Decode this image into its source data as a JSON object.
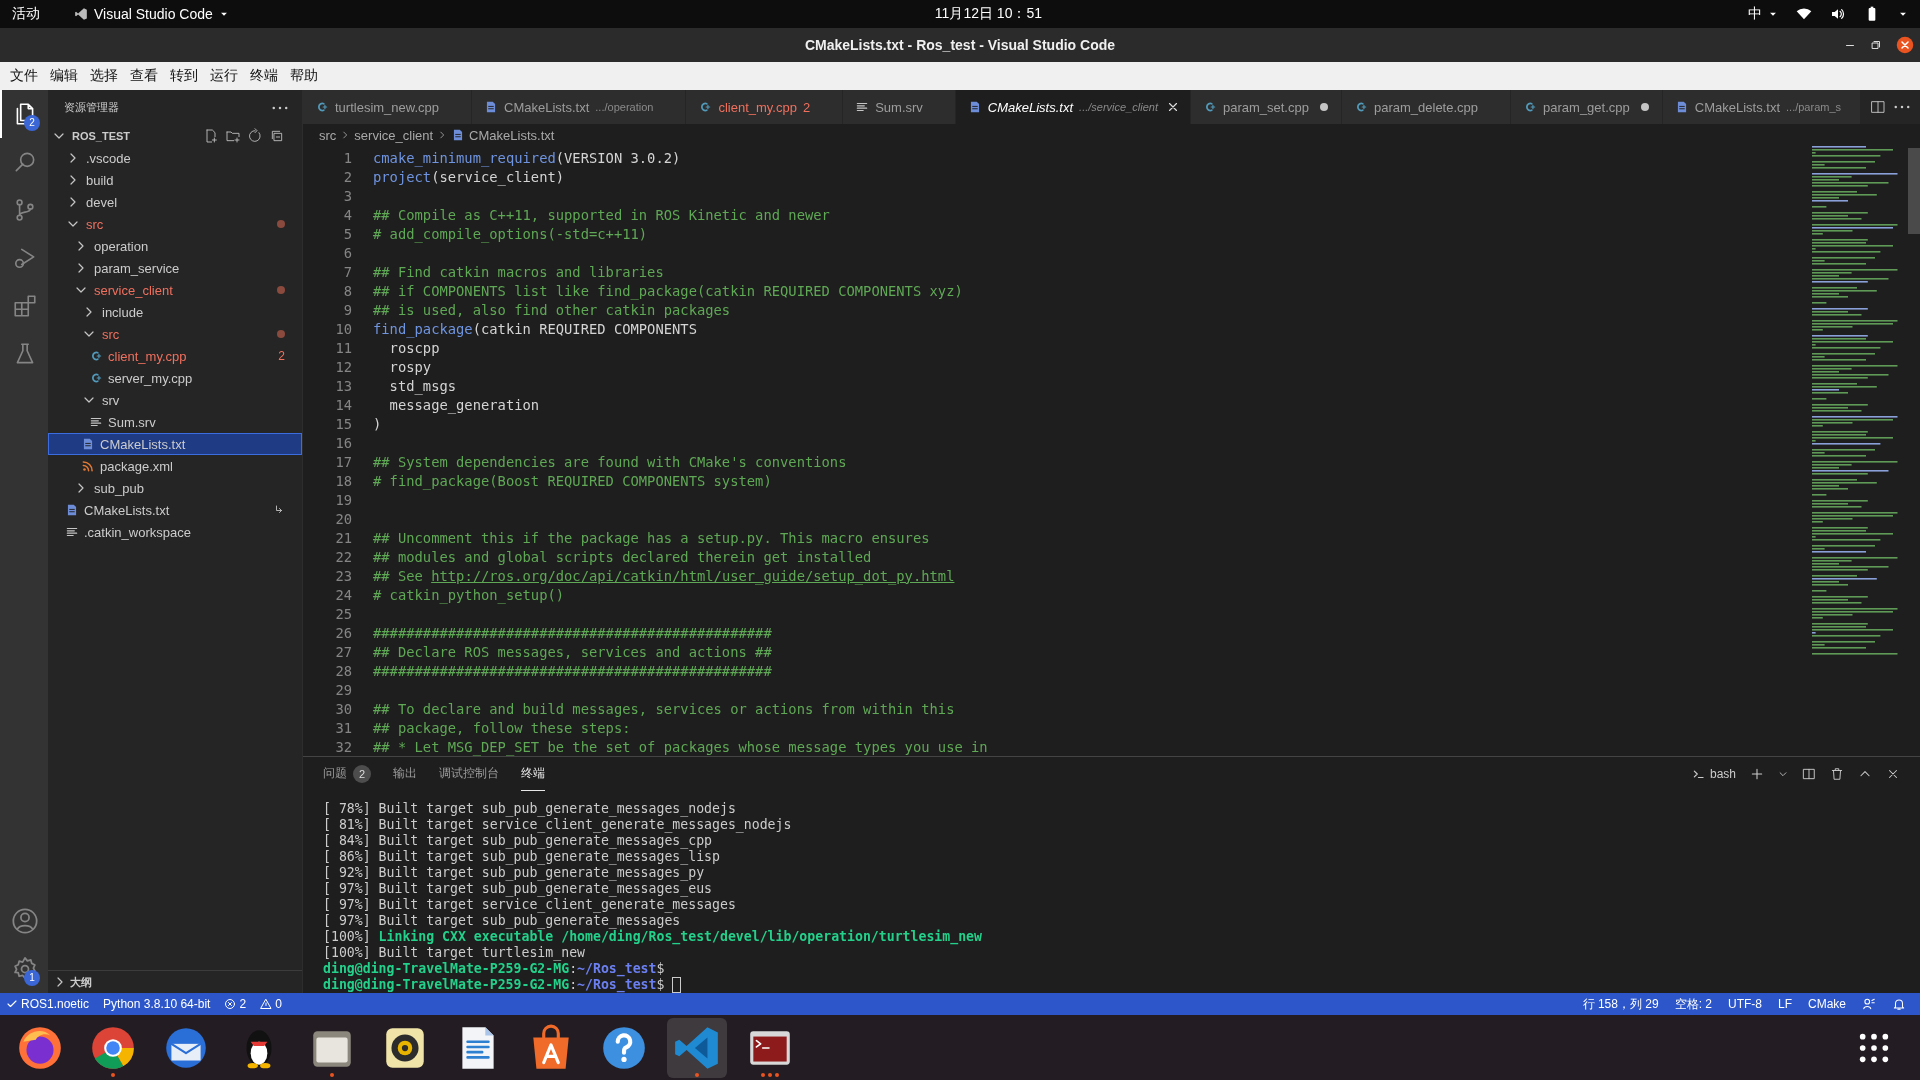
{
  "topbar": {
    "activities": "活动",
    "app_menu": "Visual Studio Code",
    "clock": "11月12日  10：51",
    "input_method": "中"
  },
  "window": {
    "title": "CMakeLists.txt - Ros_test - Visual Studio Code"
  },
  "menu": [
    "文件",
    "编辑",
    "选择",
    "查看",
    "转到",
    "运行",
    "终端",
    "帮助"
  ],
  "activity_bar": [
    {
      "kind": "explorer",
      "selected": true,
      "badge": "2"
    },
    {
      "kind": "search",
      "selected": false
    },
    {
      "kind": "source-control",
      "selected": false
    },
    {
      "kind": "run-debug",
      "selected": false
    },
    {
      "kind": "extensions",
      "selected": false
    },
    {
      "kind": "testing",
      "selected": false
    },
    {
      "kind": "account",
      "selected": false
    },
    {
      "kind": "settings",
      "selected": false,
      "badge": "1"
    }
  ],
  "sidebar": {
    "title": "资源管理器",
    "root": "ROS_TEST",
    "tree": [
      {
        "label": ".vscode",
        "kind": "folder",
        "expanded": false,
        "selected": false,
        "error": false
      },
      {
        "label": "build",
        "kind": "folder",
        "expanded": false,
        "selected": false,
        "error": false
      },
      {
        "label": "devel",
        "kind": "folder",
        "expanded": false,
        "selected": false,
        "error": false
      },
      {
        "label": "src",
        "kind": "folder",
        "expanded": true,
        "selected": false,
        "error": true,
        "children": [
          {
            "label": "operation",
            "kind": "folder",
            "expanded": false,
            "selected": false,
            "error": false
          },
          {
            "label": "param_service",
            "kind": "folder",
            "expanded": false,
            "selected": false,
            "error": false
          },
          {
            "label": "service_client",
            "kind": "folder",
            "expanded": true,
            "selected": false,
            "error": true,
            "children": [
              {
                "label": "include",
                "kind": "folder",
                "expanded": false,
                "selected": false,
                "error": false
              },
              {
                "label": "src",
                "kind": "folder",
                "expanded": true,
                "selected": false,
                "error": true,
                "children": [
                  {
                    "label": "client_my.cpp",
                    "kind": "cpp",
                    "selected": false,
                    "error": true,
                    "decoration": "2"
                  },
                  {
                    "label": "server_my.cpp",
                    "kind": "cpp",
                    "selected": false,
                    "error": false
                  }
                ]
              },
              {
                "label": "srv",
                "kind": "folder",
                "expanded": true,
                "selected": false,
                "error": false,
                "children": [
                  {
                    "label": "Sum.srv",
                    "kind": "text",
                    "selected": false,
                    "error": false
                  }
                ]
              },
              {
                "label": "CMakeLists.txt",
                "kind": "cmake",
                "selected": true,
                "error": false
              },
              {
                "label": "package.xml",
                "kind": "xml",
                "selected": false,
                "error": false
              }
            ]
          },
          {
            "label": "sub_pub",
            "kind": "folder",
            "expanded": false,
            "selected": false,
            "error": false
          }
        ]
      },
      {
        "label": "CMakeLists.txt",
        "kind": "cmake",
        "selected": false,
        "error": false,
        "linked": true
      },
      {
        "label": ".catkin_workspace",
        "kind": "text",
        "selected": false,
        "error": false
      }
    ],
    "outline": "大纲"
  },
  "tabs": [
    {
      "label": "turtlesim_new.cpp",
      "kind": "cpp",
      "selected": false,
      "modified": false,
      "error": false
    },
    {
      "label": "CMakeLists.txt",
      "description": ".../operation",
      "kind": "cmake",
      "selected": false,
      "modified": false,
      "error": false
    },
    {
      "label": "client_my.cpp",
      "count": "2",
      "kind": "cpp",
      "selected": false,
      "modified": false,
      "error": true
    },
    {
      "label": "Sum.srv",
      "kind": "text",
      "selected": false,
      "modified": false,
      "error": false
    },
    {
      "label": "CMakeLists.txt",
      "description": ".../service_client",
      "kind": "cmake",
      "selected": true,
      "modified": false,
      "error": false
    },
    {
      "label": "param_set.cpp",
      "kind": "cpp",
      "selected": false,
      "modified": true,
      "error": false
    },
    {
      "label": "param_delete.cpp",
      "kind": "cpp",
      "selected": false,
      "modified": false,
      "error": false
    },
    {
      "label": "param_get.cpp",
      "kind": "cpp",
      "selected": false,
      "modified": true,
      "error": false
    },
    {
      "label": "CMakeLists.txt",
      "description": ".../param_s",
      "kind": "cmake",
      "selected": false,
      "modified": false,
      "error": false
    }
  ],
  "breadcrumb": [
    "src",
    "service_client",
    "CMakeLists.txt"
  ],
  "code": [
    {
      "number": "1",
      "tokens": [
        {
          "kind": "fn",
          "text": "cmake_minimum_required"
        },
        {
          "kind": "plain",
          "text": "(VERSION 3.0.2)"
        }
      ]
    },
    {
      "number": "2",
      "tokens": [
        {
          "kind": "fn",
          "text": "project"
        },
        {
          "kind": "plain",
          "text": "(service_client)"
        }
      ]
    },
    {
      "number": "3"
    },
    {
      "number": "4",
      "tokens": [
        {
          "kind": "comment",
          "text": "## Compile as C++11, supported in ROS Kinetic and newer"
        }
      ]
    },
    {
      "number": "5",
      "tokens": [
        {
          "kind": "comment",
          "text": "# add_compile_options(-std=c++11)"
        }
      ]
    },
    {
      "number": "6"
    },
    {
      "number": "7",
      "tokens": [
        {
          "kind": "comment",
          "text": "## Find catkin macros and libraries"
        }
      ]
    },
    {
      "number": "8",
      "tokens": [
        {
          "kind": "comment",
          "text": "## if COMPONENTS list like find_package(catkin REQUIRED COMPONENTS xyz)"
        }
      ]
    },
    {
      "number": "9",
      "tokens": [
        {
          "kind": "comment",
          "text": "## is used, also find other catkin packages"
        }
      ]
    },
    {
      "number": "10",
      "tokens": [
        {
          "kind": "fn",
          "text": "find_package"
        },
        {
          "kind": "plain",
          "text": "(catkin REQUIRED COMPONENTS"
        }
      ]
    },
    {
      "number": "11",
      "tokens": [
        {
          "kind": "plain",
          "text": "  roscpp"
        }
      ]
    },
    {
      "number": "12",
      "tokens": [
        {
          "kind": "plain",
          "text": "  rospy"
        }
      ]
    },
    {
      "number": "13",
      "tokens": [
        {
          "kind": "plain",
          "text": "  std_msgs"
        }
      ]
    },
    {
      "number": "14",
      "tokens": [
        {
          "kind": "plain",
          "text": "  message_generation"
        }
      ]
    },
    {
      "number": "15",
      "tokens": [
        {
          "kind": "plain",
          "text": ")"
        }
      ]
    },
    {
      "number": "16"
    },
    {
      "number": "17",
      "tokens": [
        {
          "kind": "comment",
          "text": "## System dependencies are found with CMake's conventions"
        }
      ]
    },
    {
      "number": "18",
      "tokens": [
        {
          "kind": "comment",
          "text": "# find_package(Boost REQUIRED COMPONENTS system)"
        }
      ]
    },
    {
      "number": "19"
    },
    {
      "number": "20"
    },
    {
      "number": "21",
      "tokens": [
        {
          "kind": "comment",
          "text": "## Uncomment this if the package has a setup.py. This macro ensures"
        }
      ]
    },
    {
      "number": "22",
      "tokens": [
        {
          "kind": "comment",
          "text": "## modules and global scripts declared therein get installed"
        }
      ]
    },
    {
      "number": "23",
      "tokens": [
        {
          "kind": "comment",
          "text": "## See "
        },
        {
          "kind": "link",
          "text": "http://ros.org/doc/api/catkin/html/user_guide/setup_dot_py.html"
        }
      ]
    },
    {
      "number": "24",
      "tokens": [
        {
          "kind": "comment",
          "text": "# catkin_python_setup()"
        }
      ]
    },
    {
      "number": "25"
    },
    {
      "number": "26",
      "tokens": [
        {
          "kind": "comment",
          "text": "################################################"
        }
      ]
    },
    {
      "number": "27",
      "tokens": [
        {
          "kind": "comment",
          "text": "## Declare ROS messages, services and actions ##"
        }
      ]
    },
    {
      "number": "28",
      "tokens": [
        {
          "kind": "comment",
          "text": "################################################"
        }
      ]
    },
    {
      "number": "29"
    },
    {
      "number": "30",
      "tokens": [
        {
          "kind": "comment",
          "text": "## To declare and build messages, services or actions from within this"
        }
      ]
    },
    {
      "number": "31",
      "tokens": [
        {
          "kind": "comment",
          "text": "## package, follow these steps:"
        }
      ]
    },
    {
      "number": "32",
      "tokens": [
        {
          "kind": "comment",
          "text": "## * Let MSG_DEP_SET be the set of packages whose message types you use in"
        }
      ]
    }
  ],
  "panel": {
    "tabs": [
      {
        "label": "问题",
        "badge": "2",
        "selected": false
      },
      {
        "label": "输出",
        "selected": false
      },
      {
        "label": "调试控制台",
        "selected": false
      },
      {
        "label": "终端",
        "selected": true
      }
    ],
    "shell": "bash"
  },
  "terminal": [
    [
      {
        "kind": "plain",
        "text": "[ 78%] Built target sub_pub_generate_messages_nodejs"
      }
    ],
    [
      {
        "kind": "plain",
        "text": "[ 81%] Built target service_client_generate_messages_nodejs"
      }
    ],
    [
      {
        "kind": "plain",
        "text": "[ 84%] Built target sub_pub_generate_messages_cpp"
      }
    ],
    [
      {
        "kind": "plain",
        "text": "[ 86%] Built target sub_pub_generate_messages_lisp"
      }
    ],
    [
      {
        "kind": "plain",
        "text": "[ 92%] Built target sub_pub_generate_messages_py"
      }
    ],
    [
      {
        "kind": "plain",
        "text": "[ 97%] Built target sub_pub_generate_messages_eus"
      }
    ],
    [
      {
        "kind": "plain",
        "text": "[ 97%] Built target service_client_generate_messages"
      }
    ],
    [
      {
        "kind": "plain",
        "text": "[ 97%] Built target sub_pub_generate_messages"
      }
    ],
    [
      {
        "kind": "plain",
        "text": "[100%] "
      },
      {
        "kind": "green",
        "text": "Linking CXX executable /home/ding/Ros_test/devel/lib/operation/turtlesim_new"
      }
    ],
    [
      {
        "kind": "plain",
        "text": "[100%] Built target turtlesim_new"
      }
    ],
    [
      {
        "kind": "green",
        "text": "ding@ding-TravelMate-P259-G2-MG"
      },
      {
        "kind": "plain",
        "text": ":"
      },
      {
        "kind": "path",
        "text": "~/Ros_test"
      },
      {
        "kind": "plain",
        "text": "$"
      }
    ],
    [
      {
        "kind": "green",
        "text": "ding@ding-TravelMate-P259-G2-MG"
      },
      {
        "kind": "plain",
        "text": ":"
      },
      {
        "kind": "path",
        "text": "~/Ros_test"
      },
      {
        "kind": "plain",
        "text": "$ "
      },
      {
        "kind": "cursor"
      }
    ]
  ],
  "status_bar": {
    "left": [
      {
        "kind": "check",
        "text": "ROS1.noetic"
      },
      {
        "kind": "plain",
        "text": "Python 3.8.10 64-bit"
      },
      {
        "kind": "error",
        "text": "2"
      },
      {
        "kind": "warning",
        "text": "0"
      }
    ],
    "right": [
      {
        "kind": "plain",
        "text": "行 158，列 29"
      },
      {
        "kind": "plain",
        "text": "空格: 2"
      },
      {
        "kind": "plain",
        "text": "UTF-8"
      },
      {
        "kind": "plain",
        "text": "LF"
      },
      {
        "kind": "plain",
        "text": "CMake"
      },
      {
        "kind": "feedback"
      },
      {
        "kind": "bell"
      }
    ]
  },
  "dock": [
    {
      "kind": "firefox",
      "running": false,
      "selected": false
    },
    {
      "kind": "chrome",
      "running": true,
      "multiple": false,
      "selected": false
    },
    {
      "kind": "mail",
      "running": false,
      "selected": false
    },
    {
      "kind": "penguin",
      "running": false,
      "selected": false
    },
    {
      "kind": "files",
      "running": true,
      "multiple": false,
      "selected": false
    },
    {
      "kind": "music",
      "running": false,
      "selected": false
    },
    {
      "kind": "writer",
      "running": false,
      "selected": false
    },
    {
      "kind": "software",
      "running": false,
      "selected": false
    },
    {
      "kind": "help",
      "running": false,
      "selected": false
    },
    {
      "kind": "vscode",
      "running": true,
      "multiple": false,
      "selected": true
    },
    {
      "kind": "terminal",
      "running": true,
      "multiple": true,
      "selected": false
    },
    {
      "kind": "apps",
      "running": false,
      "selected": false
    }
  ]
}
